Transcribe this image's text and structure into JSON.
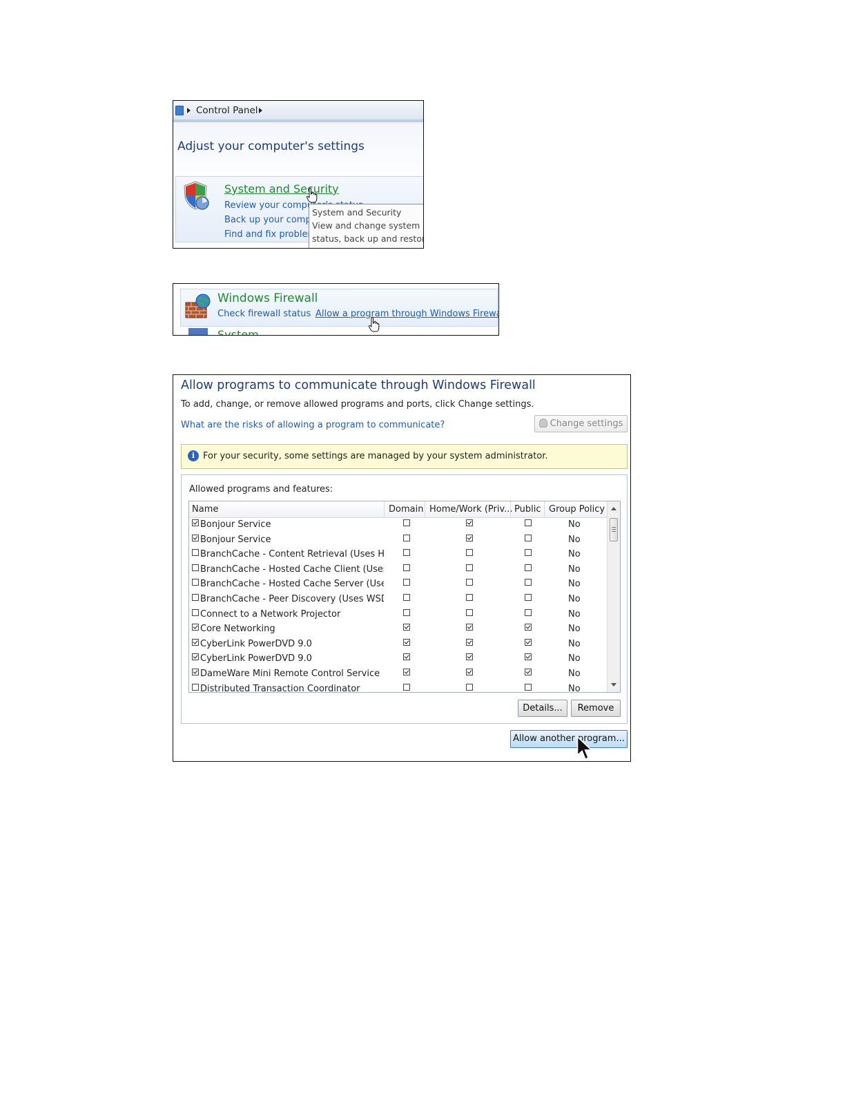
{
  "control_panel": {
    "breadcrumb": "Control Panel",
    "title": "Adjust your computer's settings",
    "category": {
      "title": "System and Security",
      "links": [
        "Review your computer's status",
        "Back up your computer",
        "Find and fix problems"
      ]
    },
    "tooltip": {
      "title": "System and Security",
      "line1": "View and change system and",
      "line2": "status, back up and restore"
    }
  },
  "firewall_item": {
    "title": "Windows Firewall",
    "link_status": "Check firewall status",
    "link_allow": "Allow a program through Windows Firewall",
    "next_item": "System"
  },
  "allowed_programs": {
    "title": "Allow programs to communicate through Windows Firewall",
    "intro": "To add, change, or remove allowed programs and ports, click Change settings.",
    "risks_link": "What are the risks of allowing a program to communicate?",
    "change_settings_label": "Change settings",
    "info_text": "For your security, some settings are managed by your system administrator.",
    "list_label": "Allowed programs and features:",
    "columns": [
      "Name",
      "Domain",
      "Home/Work (Priv...",
      "Public",
      "Group Policy"
    ],
    "rows": [
      {
        "name": "Bonjour Service",
        "enabled": true,
        "domain": false,
        "home": true,
        "public": false,
        "gp": "No"
      },
      {
        "name": "Bonjour Service",
        "enabled": true,
        "domain": false,
        "home": true,
        "public": false,
        "gp": "No"
      },
      {
        "name": "BranchCache - Content Retrieval (Uses HTTP)",
        "enabled": false,
        "domain": false,
        "home": false,
        "public": false,
        "gp": "No"
      },
      {
        "name": "BranchCache - Hosted Cache Client (Uses H...",
        "enabled": false,
        "domain": false,
        "home": false,
        "public": false,
        "gp": "No"
      },
      {
        "name": "BranchCache - Hosted Cache Server (Uses ...",
        "enabled": false,
        "domain": false,
        "home": false,
        "public": false,
        "gp": "No"
      },
      {
        "name": "BranchCache - Peer Discovery (Uses WSD)",
        "enabled": false,
        "domain": false,
        "home": false,
        "public": false,
        "gp": "No"
      },
      {
        "name": "Connect to a Network Projector",
        "enabled": false,
        "domain": false,
        "home": false,
        "public": false,
        "gp": "No"
      },
      {
        "name": "Core Networking",
        "enabled": true,
        "domain": true,
        "home": true,
        "public": true,
        "gp": "No"
      },
      {
        "name": "CyberLink PowerDVD 9.0",
        "enabled": true,
        "domain": true,
        "home": true,
        "public": true,
        "gp": "No"
      },
      {
        "name": "CyberLink PowerDVD 9.0",
        "enabled": true,
        "domain": true,
        "home": true,
        "public": true,
        "gp": "No"
      },
      {
        "name": "DameWare Mini Remote Control Service",
        "enabled": true,
        "domain": true,
        "home": true,
        "public": true,
        "gp": "No"
      },
      {
        "name": "Distributed Transaction Coordinator",
        "enabled": false,
        "domain": false,
        "home": false,
        "public": false,
        "gp": "No"
      }
    ],
    "details_label": "Details...",
    "remove_label": "Remove",
    "allow_another_label": "Allow another program..."
  }
}
